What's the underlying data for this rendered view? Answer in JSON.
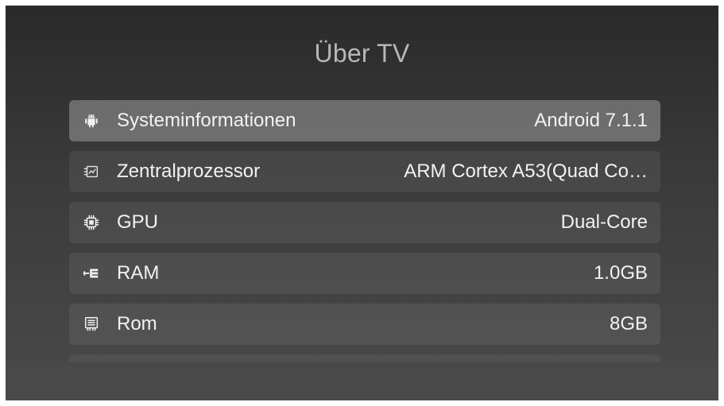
{
  "screen": {
    "title": "Über TV"
  },
  "items": [
    {
      "label": "Systeminformationen",
      "value": "Android 7.1.1",
      "icon": "android-icon",
      "focused": true
    },
    {
      "label": "Zentralprozessor",
      "value": "ARM Cortex A53(Quad Co…",
      "icon": "processor-icon",
      "focused": false
    },
    {
      "label": "GPU",
      "value": "Dual-Core",
      "icon": "chip-icon",
      "focused": false
    },
    {
      "label": "RAM",
      "value": "1.0GB",
      "icon": "memory-icon",
      "focused": false
    },
    {
      "label": "Rom",
      "value": "8GB",
      "icon": "storage-icon",
      "focused": false
    }
  ],
  "colors": {
    "text": "#f2f2f2",
    "title": "#b8b8b8",
    "focus_row": "#6b6b6b"
  }
}
